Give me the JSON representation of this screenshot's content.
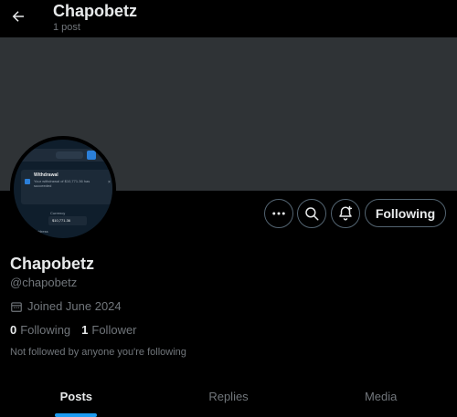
{
  "header": {
    "title": "Chapobetz",
    "subtitle": "1 post",
    "back_icon": "arrow-left-icon"
  },
  "colors": {
    "background": "#000000",
    "banner": "#2f3336",
    "accent": "#1d9bf0",
    "muted_text": "#71767b",
    "primary_text": "#e7e9ea",
    "border": "#536471"
  },
  "avatar": {
    "popup_title": "Withdrawal",
    "popup_text": "Your withdrawal of $10,771.36 has succeeded",
    "small_label": "Currency",
    "amount": "$10,771.36",
    "btc_label": "BTC Address"
  },
  "actions": {
    "more_icon": "more-icon",
    "search_icon": "search-icon",
    "notify_icon": "bell-plus-icon",
    "following_label": "Following"
  },
  "profile": {
    "display_name": "Chapobetz",
    "handle": "@chapobetz",
    "joined": "Joined June 2024",
    "following_count": "0",
    "following_label": "Following",
    "followers_count": "1",
    "followers_label": "Follower",
    "not_followed": "Not followed by anyone you're following"
  },
  "tabs": [
    {
      "label": "Posts",
      "active": true
    },
    {
      "label": "Replies",
      "active": false
    },
    {
      "label": "Media",
      "active": false
    }
  ]
}
